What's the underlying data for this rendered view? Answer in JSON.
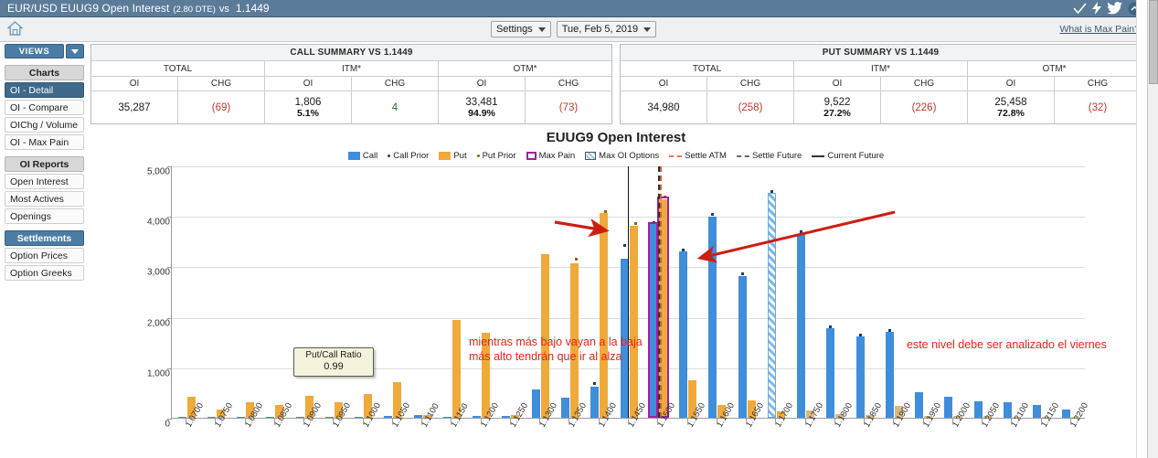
{
  "window": {
    "title_main": "EUR/USD EUUG9 Open Interest",
    "title_dte": "(2.80 DTE)",
    "title_vs": "vs",
    "title_price": "1.1449",
    "icons": [
      "check-icon",
      "lightning-icon",
      "twitter-icon",
      "collapse-icon"
    ]
  },
  "toolbar": {
    "home_icon": "home-icon",
    "settings_label": "Settings",
    "date_label": "Tue, Feb 5, 2019",
    "max_pain_link": "What is Max Pain?"
  },
  "sidebar": {
    "views_label": "VIEWS",
    "groups": [
      {
        "label": "Charts",
        "accent": false,
        "items": [
          "OI - Detail",
          "OI - Compare",
          "OIChg / Volume",
          "OI - Max Pain"
        ],
        "active": "OI - Detail"
      },
      {
        "label": "OI Reports",
        "accent": false,
        "items": [
          "Open Interest",
          "Most Actives",
          "Openings"
        ],
        "active": ""
      },
      {
        "label": "Settlements",
        "accent": true,
        "items": [
          "Option Prices",
          "Option Greeks"
        ],
        "active": ""
      }
    ]
  },
  "summaries": [
    {
      "title": "CALL SUMMARY VS 1.1449",
      "groups": [
        "TOTAL",
        "ITM*",
        "OTM*"
      ],
      "headers": [
        "OI",
        "CHG",
        "OI",
        "CHG",
        "OI",
        "CHG"
      ],
      "cells": [
        {
          "main": "35,287",
          "sub": "",
          "tone": "normal"
        },
        {
          "main": "(69)",
          "sub": "",
          "tone": "neg"
        },
        {
          "main": "1,806",
          "sub": "5.1%",
          "tone": "normal"
        },
        {
          "main": "4",
          "sub": "",
          "tone": "pos"
        },
        {
          "main": "33,481",
          "sub": "94.9%",
          "tone": "normal"
        },
        {
          "main": "(73)",
          "sub": "",
          "tone": "neg"
        }
      ]
    },
    {
      "title": "PUT SUMMARY VS 1.1449",
      "groups": [
        "TOTAL",
        "ITM*",
        "OTM*"
      ],
      "headers": [
        "OI",
        "CHG",
        "OI",
        "CHG",
        "OI",
        "CHG"
      ],
      "cells": [
        {
          "main": "34,980",
          "sub": "",
          "tone": "normal"
        },
        {
          "main": "(258)",
          "sub": "",
          "tone": "neg"
        },
        {
          "main": "9,522",
          "sub": "27.2%",
          "tone": "normal"
        },
        {
          "main": "(226)",
          "sub": "",
          "tone": "neg"
        },
        {
          "main": "25,458",
          "sub": "72.8%",
          "tone": "normal"
        },
        {
          "main": "(32)",
          "sub": "",
          "tone": "neg"
        }
      ]
    }
  ],
  "chart_data": {
    "type": "bar",
    "title": "EUUG9 Open Interest",
    "xlabel": "",
    "ylabel": "",
    "ylim": [
      0,
      5000
    ],
    "yticks": [
      0,
      1000,
      2000,
      3000,
      4000,
      5000
    ],
    "ytick_labels": [
      "0",
      "1,000",
      "2,000",
      "3,000",
      "4,000",
      "5,000"
    ],
    "grid": true,
    "legend_position": "top",
    "legend": [
      {
        "label": "Call",
        "marker": "square",
        "color": "#3f8edc"
      },
      {
        "label": "Call Prior",
        "marker": "dot",
        "color": "#1b3f63"
      },
      {
        "label": "Put",
        "marker": "square",
        "color": "#f0a93b"
      },
      {
        "label": "Put Prior",
        "marker": "dot",
        "color": "#8a6410"
      },
      {
        "label": "Max Pain",
        "marker": "outline-square",
        "color": "#a020a0"
      },
      {
        "label": "Max OI Options",
        "marker": "hatched-square",
        "color": "#7fb6e8"
      },
      {
        "label": "Settle ATM",
        "marker": "dashed-line",
        "color": "#e07a5f"
      },
      {
        "label": "Settle Future",
        "marker": "dashed-line",
        "color": "#6b6b6b"
      },
      {
        "label": "Current Future",
        "marker": "solid-line",
        "color": "#333333"
      }
    ],
    "categories": [
      "1.0700",
      "1.0750",
      "1.0800",
      "1.0850",
      "1.0900",
      "1.0950",
      "1.1000",
      "1.1050",
      "1.1100",
      "1.1150",
      "1.1200",
      "1.1250",
      "1.1300",
      "1.1350",
      "1.1400",
      "1.1450",
      "1.1500",
      "1.1550",
      "1.1600",
      "1.1650",
      "1.1700",
      "1.1750",
      "1.1800",
      "1.1850",
      "1.1900",
      "1.1950",
      "1.2000",
      "1.2050",
      "1.2100",
      "1.2150",
      "1.2200"
    ],
    "series": [
      {
        "name": "Call",
        "color": "#3f8edc",
        "values": [
          20,
          15,
          20,
          15,
          20,
          20,
          25,
          30,
          60,
          25,
          40,
          45,
          560,
          400,
          610,
          3150,
          3840,
          3300,
          3990,
          2800,
          4450,
          3650,
          1780,
          1610,
          1700,
          500,
          410,
          320,
          300,
          260,
          160
        ]
      },
      {
        "name": "Put",
        "color": "#f0a93b",
        "values": [
          420,
          160,
          310,
          250,
          430,
          300,
          470,
          700,
          60,
          1940,
          1690,
          60,
          3240,
          3060,
          4050,
          3800,
          4330,
          740,
          260,
          340,
          120,
          150,
          80,
          60,
          240,
          40,
          40,
          30,
          20,
          15,
          15
        ]
      },
      {
        "name": "Call Prior",
        "color": "#1b3f63",
        "values": [
          null,
          null,
          null,
          null,
          null,
          null,
          null,
          null,
          null,
          null,
          null,
          null,
          null,
          null,
          660,
          3380,
          3840,
          3300,
          4010,
          2820,
          4460,
          3660,
          1780,
          1610,
          1700,
          null,
          null,
          null,
          null,
          null,
          null
        ]
      },
      {
        "name": "Put Prior",
        "color": "#8a6410",
        "values": [
          null,
          null,
          null,
          null,
          null,
          null,
          null,
          null,
          null,
          null,
          null,
          null,
          null,
          3110,
          4060,
          3830,
          4350,
          null,
          null,
          null,
          null,
          null,
          null,
          null,
          null,
          null,
          null,
          null,
          null,
          null,
          null
        ]
      }
    ],
    "max_pain_strike": "1.1500",
    "max_pain_value": 4330,
    "max_oi_strike": "1.1700",
    "max_oi_value": 4450,
    "current_future_strike": "1.1449",
    "settle_future_strike": "1.1470",
    "settle_atm_strike": "1.1470",
    "put_call_ratio_label": "Put/Call Ratio",
    "put_call_ratio_value": "0.99",
    "annotations": [
      {
        "text": "mientras más bajo vayan a la baja\nmás alto tendrán que ir al alza",
        "color": "#e8241a"
      },
      {
        "text": "este nivel debe ser analizado el viernes",
        "color": "#e8241a"
      }
    ]
  }
}
